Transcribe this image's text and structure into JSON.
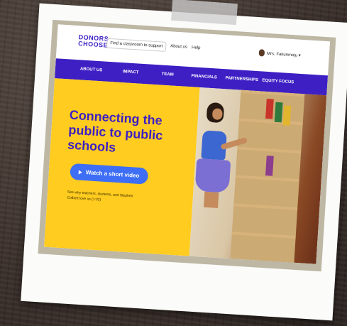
{
  "header": {
    "logo_line1": "DONORS",
    "logo_line2": "CHOOSE",
    "find_classroom": "Find a classroom to support",
    "about_link": "About us",
    "help_link": "Help",
    "user_name": "Mrs. Fakunmoju ▾"
  },
  "nav": {
    "items": [
      "ABOUT US",
      "IMPACT",
      "TEAM",
      "FINANCIALS",
      "PARTNERSHIPS",
      "EQUITY FOCUS"
    ]
  },
  "hero": {
    "title": "Connecting the public to public schools",
    "button_label": "Watch a short video",
    "caption": "See why teachers, students, and Stephen Colbert love us (1:32)"
  },
  "colors": {
    "brand_purple": "#3d1fc4",
    "hero_yellow": "#ffcc1f",
    "button_blue": "#3d6ef5"
  }
}
